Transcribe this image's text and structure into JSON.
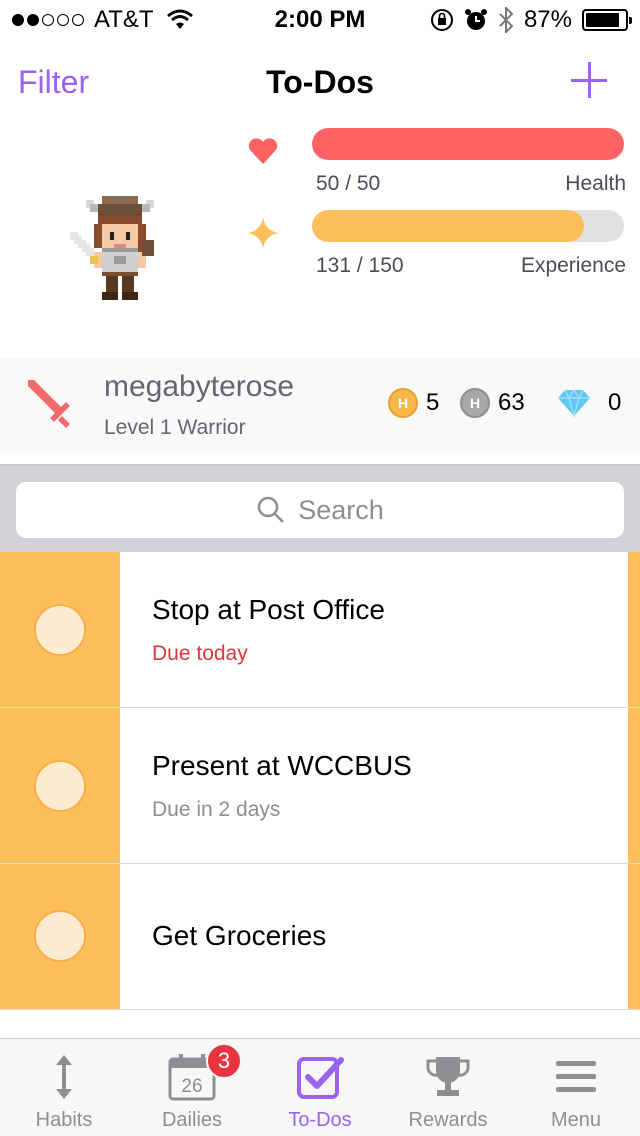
{
  "status_bar": {
    "carrier": "AT&T",
    "time": "2:00 PM",
    "battery": "87%",
    "battery_level": 0.87,
    "signal_bars_filled": 2,
    "signal_bars_total": 5
  },
  "nav": {
    "filter_label": "Filter",
    "title": "To-Dos",
    "add_icon": "plus-icon",
    "accent_color": "#9a62ef"
  },
  "stats": {
    "health": {
      "value_text": "50 / 50",
      "label": "Health",
      "current": 50,
      "max": 50,
      "color": "#ff6165",
      "icon": "heart-icon"
    },
    "experience": {
      "value_text": "131 / 150",
      "label": "Experience",
      "current": 131,
      "max": 150,
      "color": "#ffbe5c",
      "icon": "star-icon"
    }
  },
  "user": {
    "name": "megabyterose",
    "level": "Level 1 Warrior",
    "class_icon": "sword-icon",
    "gold": "5",
    "silver": "63",
    "gems": "0"
  },
  "search": {
    "placeholder": "Search"
  },
  "todos": [
    {
      "title": "Stop at Post Office",
      "due": "Due today",
      "due_color": "#e0363c"
    },
    {
      "title": "Present at WCCBUS",
      "due": "Due in 2 days",
      "due_color": "#8e8e93"
    },
    {
      "title": "Get Groceries",
      "due": "",
      "due_color": "#8e8e93"
    }
  ],
  "tabs": [
    {
      "label": "Habits",
      "icon": "arrows-vertical-icon",
      "active": false
    },
    {
      "label": "Dailies",
      "icon": "calendar-icon",
      "badge": "3",
      "calendar_day": "26",
      "active": false
    },
    {
      "label": "To-Dos",
      "icon": "checkbox-icon",
      "active": true
    },
    {
      "label": "Rewards",
      "icon": "trophy-icon",
      "active": false
    },
    {
      "label": "Menu",
      "icon": "menu-icon",
      "active": false
    }
  ]
}
